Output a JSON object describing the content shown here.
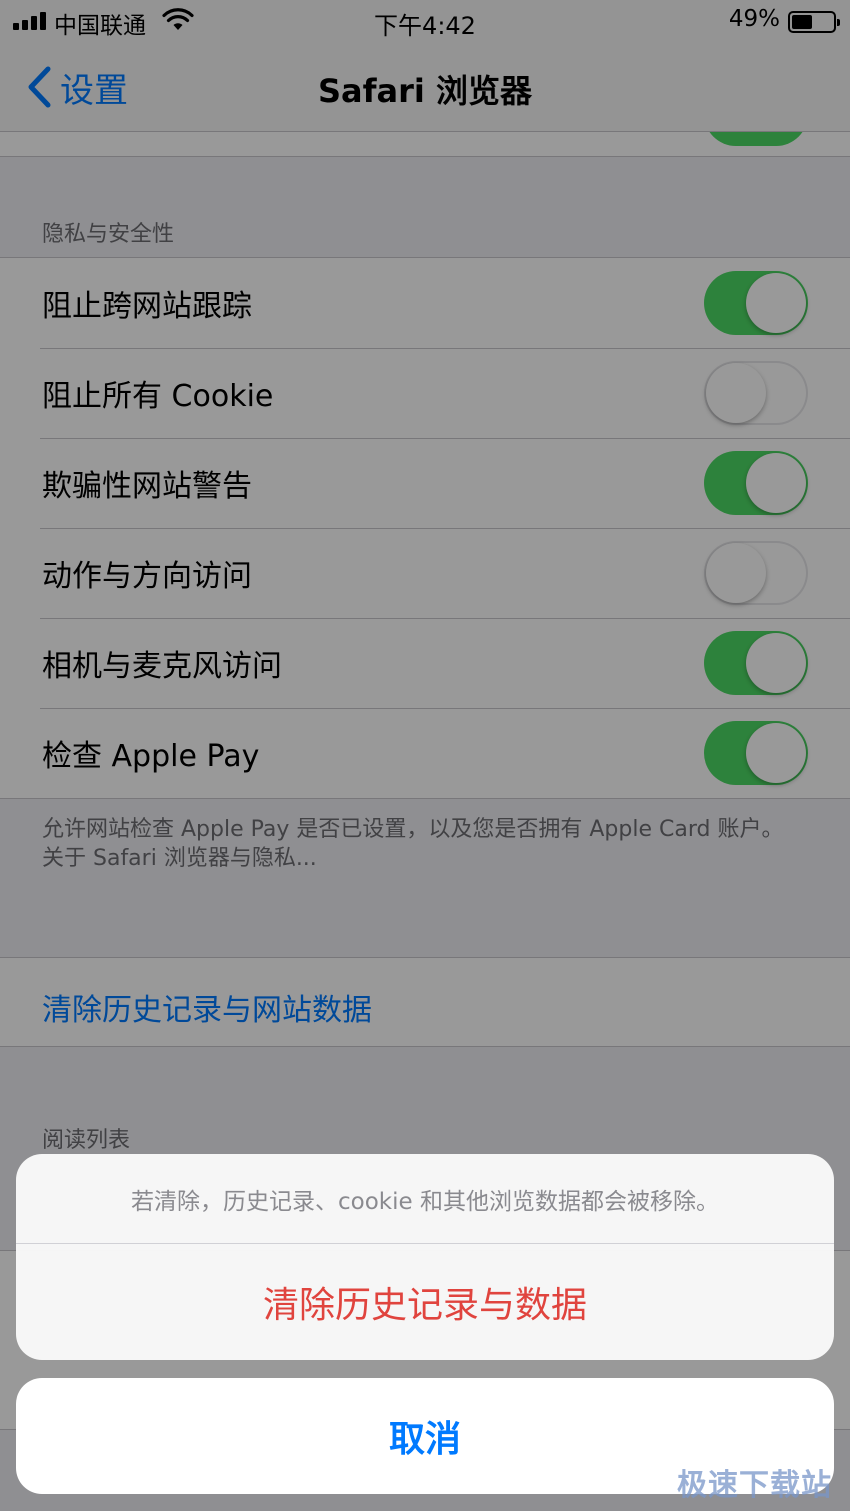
{
  "status_bar": {
    "carrier": "中国联通",
    "time": "下午4:42",
    "battery_percent": "49%",
    "battery_level": 0.49,
    "signal_bars": 4,
    "wifi": true
  },
  "nav": {
    "back_label": "设置",
    "title": "Safari 浏览器"
  },
  "privacy_section": {
    "header": "隐私与安全性",
    "rows": [
      {
        "label": "阻止跨网站跟踪",
        "on": true
      },
      {
        "label": "阻止所有 Cookie",
        "on": false
      },
      {
        "label": "欺骗性网站警告",
        "on": true
      },
      {
        "label": "动作与方向访问",
        "on": false
      },
      {
        "label": "相机与麦克风访问",
        "on": true
      },
      {
        "label": "检查 Apple Pay",
        "on": true
      }
    ],
    "footer_note": "允许网站检查 Apple Pay 是否已设置，以及您是否拥有 Apple Card 账户。",
    "footer_link": "关于 Safari 浏览器与隐私..."
  },
  "clear_history_row": {
    "label": "清除历史记录与网站数据"
  },
  "reading_list_section": {
    "header": "阅读列表"
  },
  "action_sheet": {
    "message": "若清除，历史记录、cookie 和其他浏览数据都会被移除。",
    "destructive_label": "清除历史记录与数据",
    "cancel_label": "取消"
  },
  "watermark": "极速下载站",
  "colors": {
    "switch_on": "#4cd964",
    "link_blue": "#007aff",
    "destructive_red": "#e0443e"
  }
}
